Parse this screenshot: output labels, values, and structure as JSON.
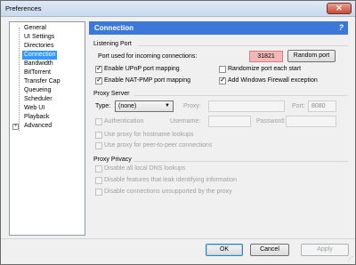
{
  "window": {
    "title": "Preferences",
    "close_glyph": "✕"
  },
  "sidebar": {
    "expand_glyph": "+",
    "items": [
      {
        "label": "General"
      },
      {
        "label": "UI Settings"
      },
      {
        "label": "Directories"
      },
      {
        "label": "Connection",
        "selected": true
      },
      {
        "label": "Bandwidth"
      },
      {
        "label": "BitTorrent"
      },
      {
        "label": "Transfer Cap"
      },
      {
        "label": "Queueing"
      },
      {
        "label": "Scheduler"
      },
      {
        "label": "Web UI"
      },
      {
        "label": "Playback"
      },
      {
        "label": "Advanced"
      }
    ]
  },
  "header": {
    "title": "Connection",
    "help_glyph": "?"
  },
  "listening_port": {
    "section_label": "Listening Port",
    "port_label": "Port used for incoming connections:",
    "port_value": "31821",
    "random_port_button": "Random port",
    "upnp_label": "Enable UPnP port mapping",
    "upnp_checked": true,
    "randomize_label": "Randomize port each start",
    "randomize_checked": false,
    "natpmp_label": "Enable NAT-PMP port mapping",
    "natpmp_checked": true,
    "firewall_label": "Add Windows Firewall exception",
    "firewall_checked": true
  },
  "proxy_server": {
    "section_label": "Proxy Server",
    "type_label": "Type:",
    "type_value": "(none)",
    "proxy_label": "Proxy:",
    "port_label": "Port:",
    "port_value": "8080",
    "auth_label": "Authentication",
    "username_label": "Username:",
    "password_label": "Password:",
    "hostname_label": "Use proxy for hostname lookups",
    "p2p_label": "Use proxy for peer-to-peer connections"
  },
  "proxy_privacy": {
    "section_label": "Proxy Privacy",
    "dns_label": "Disable all local DNS lookups",
    "leak_label": "Disable features that leak identifying information",
    "unsupported_label": "Disable connections unsupported by the proxy"
  },
  "footer": {
    "ok": "OK",
    "cancel": "Cancel",
    "apply": "Apply"
  },
  "checkmark": "✓",
  "dropdown_arrow": "▼",
  "resize_glyph": "⋰"
}
